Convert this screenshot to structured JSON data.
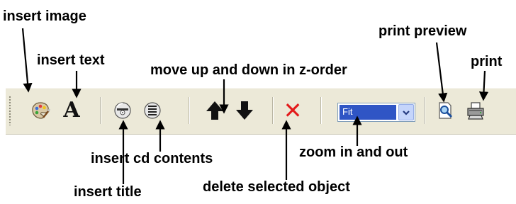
{
  "labels": {
    "insert_image": "insert image",
    "insert_text": "insert text",
    "move_z_order": "move up and down in z-order",
    "print_preview": "print preview",
    "print": "print",
    "insert_cd_contents": "insert cd contents",
    "zoom": "zoom in and out",
    "insert_title": "insert title",
    "delete_object": "delete selected object"
  },
  "toolbar": {
    "buttons": [
      {
        "name": "insert-image",
        "icon": "palette-icon"
      },
      {
        "name": "insert-text",
        "icon": "letter-a-icon",
        "glyph": "A"
      },
      {
        "name": "insert-title",
        "icon": "cd-icon"
      },
      {
        "name": "insert-cd-contents",
        "icon": "cd-list-icon"
      },
      {
        "name": "move-up",
        "icon": "arrow-up-icon"
      },
      {
        "name": "move-down",
        "icon": "arrow-down-icon"
      },
      {
        "name": "delete",
        "icon": "red-x-icon",
        "glyph": "✕"
      },
      {
        "name": "print-preview",
        "icon": "magnifier-page-icon"
      },
      {
        "name": "print",
        "icon": "printer-icon"
      }
    ],
    "zoom_select": {
      "value": "Fit"
    }
  },
  "colors": {
    "toolbar_bg": "#ece9d8",
    "select_highlight": "#2f55c5",
    "delete_red": "#e31b1b"
  }
}
